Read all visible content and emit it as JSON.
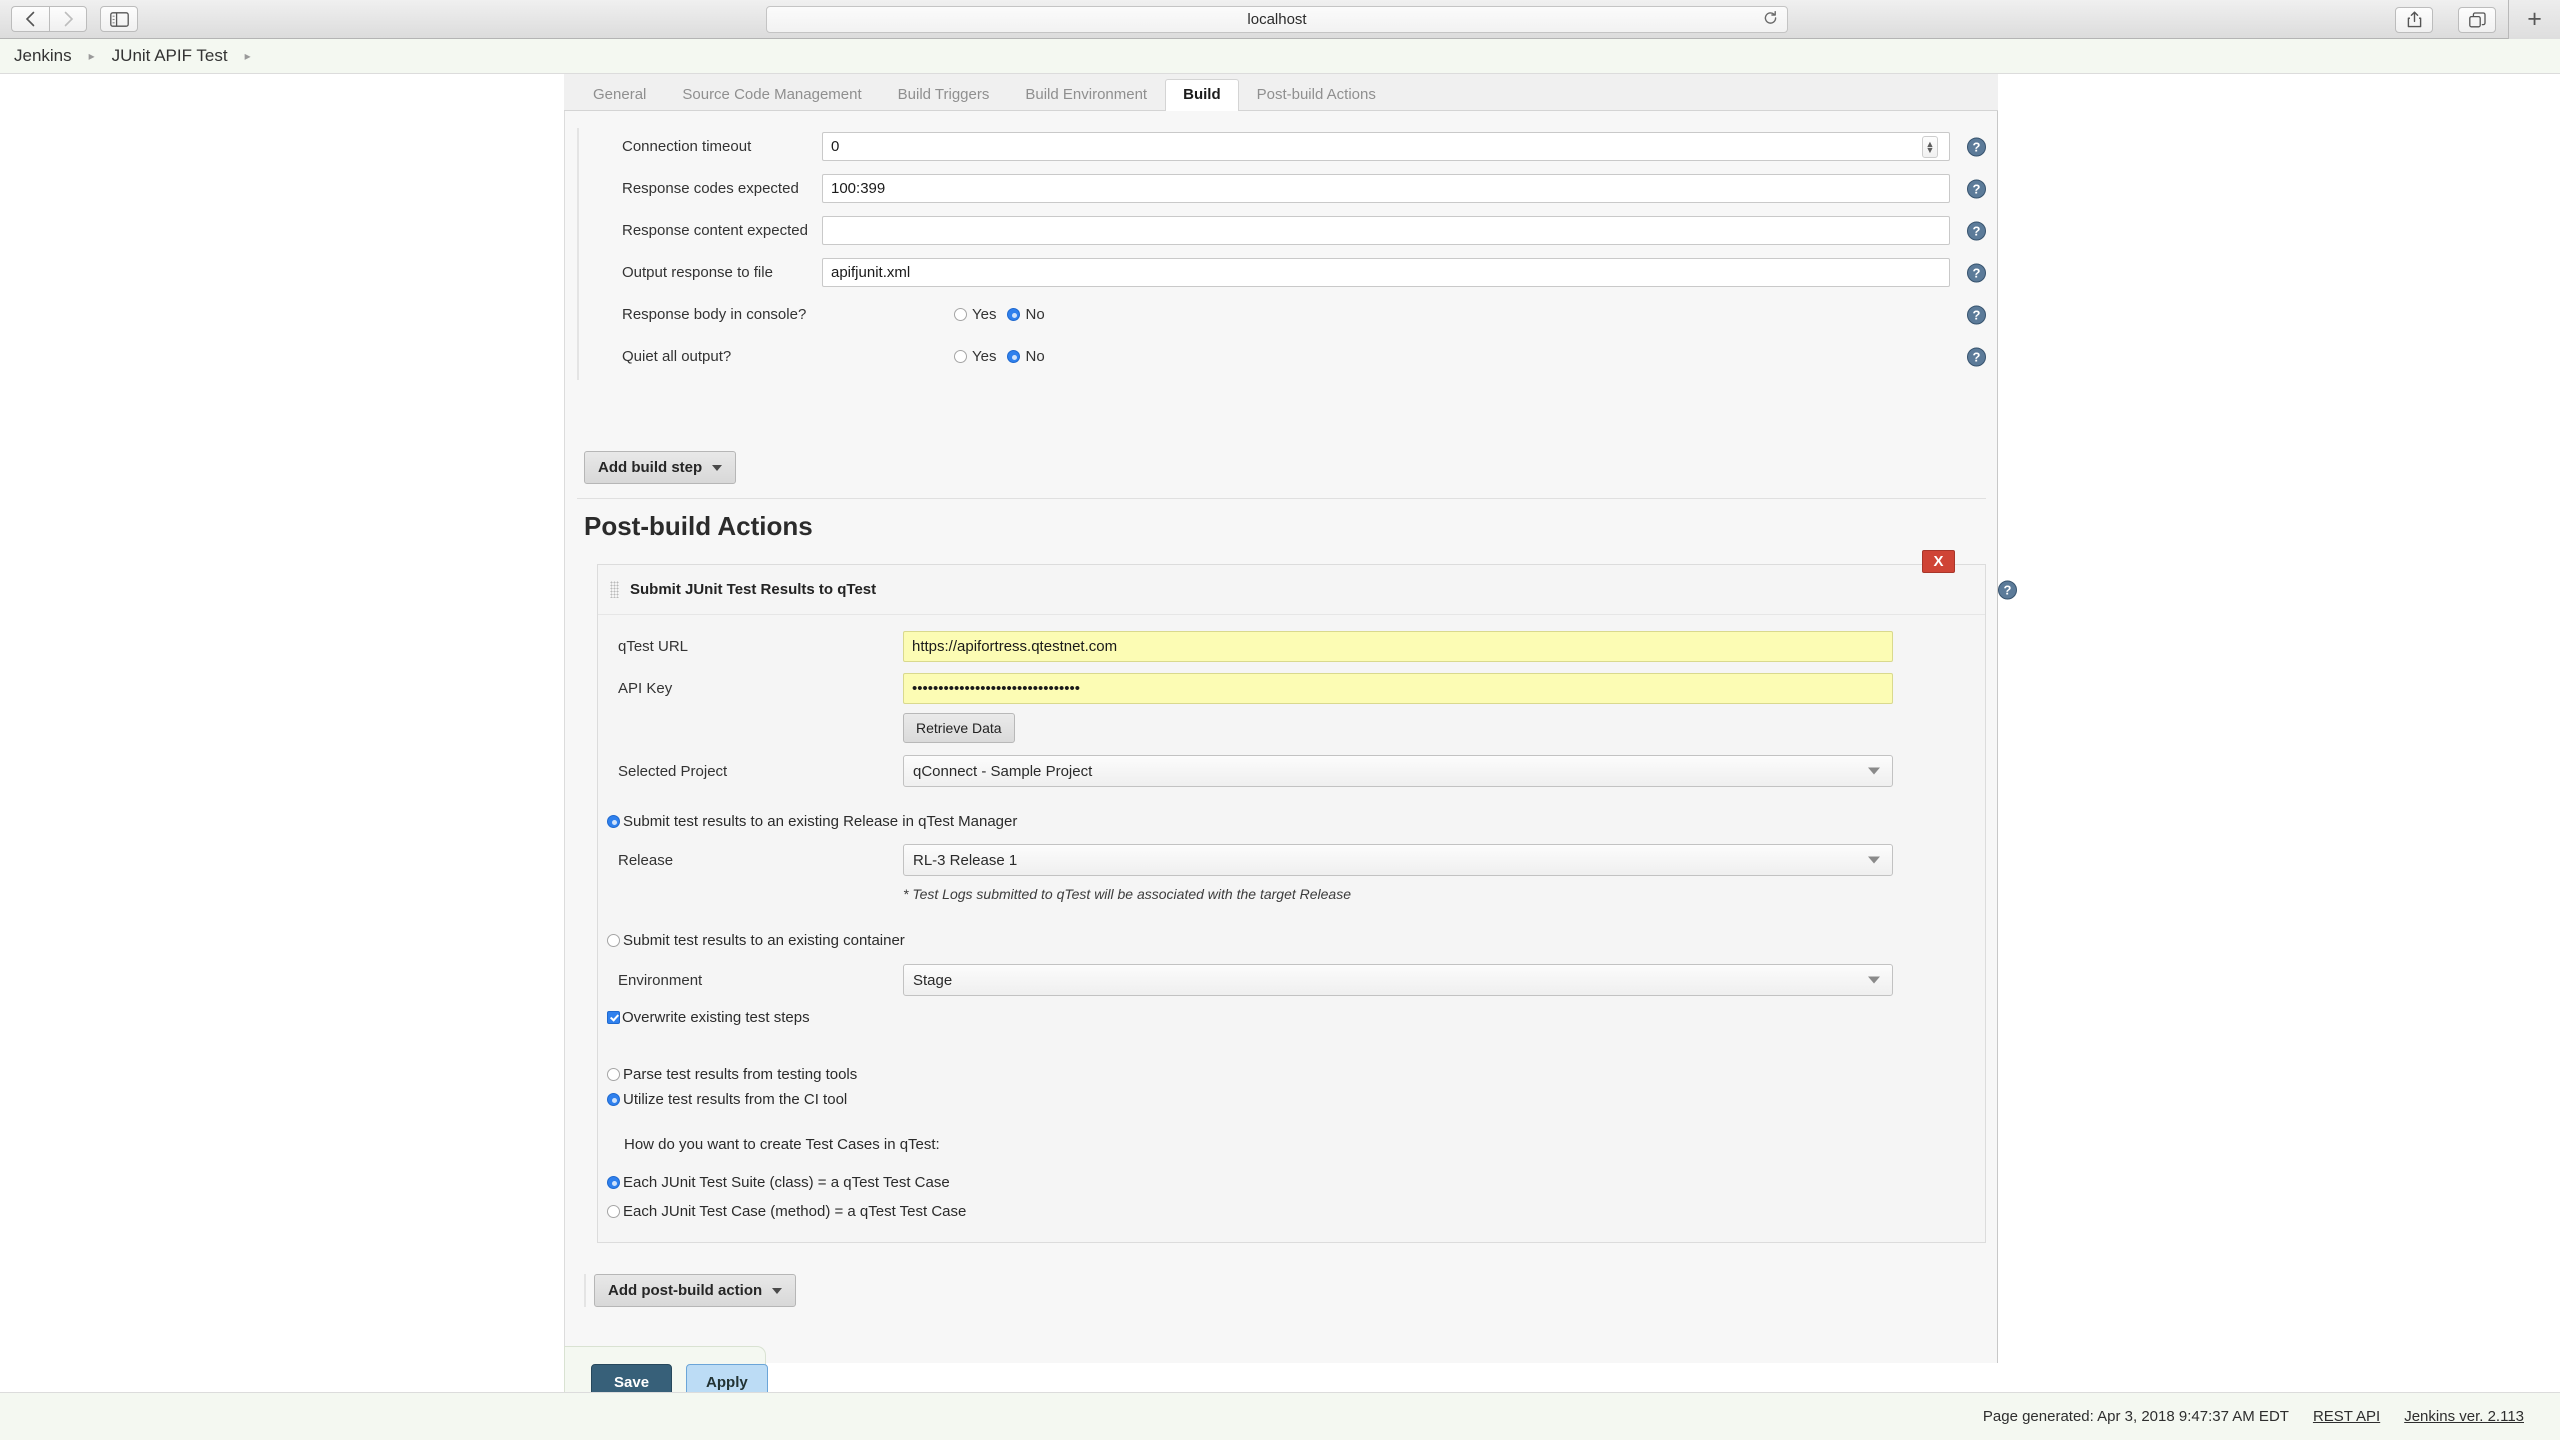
{
  "browser": {
    "url": "localhost",
    "back_icon": "chevron-left-icon",
    "forward_icon": "chevron-right-icon",
    "sidebar_icon": "sidebar-toggle-icon",
    "reload_icon": "reload-icon",
    "share_icon": "share-icon",
    "tabs_icon": "show-tabs-icon",
    "newtab_label": "+"
  },
  "breadcrumb": {
    "items": [
      {
        "label": "Jenkins"
      },
      {
        "label": "JUnit APIF Test"
      }
    ],
    "separator": "▸"
  },
  "tabs": [
    {
      "label": "General",
      "active": false
    },
    {
      "label": "Source Code Management",
      "active": false
    },
    {
      "label": "Build Triggers",
      "active": false
    },
    {
      "label": "Build Environment",
      "active": false
    },
    {
      "label": "Build",
      "active": true
    },
    {
      "label": "Post-build Actions",
      "active": false
    }
  ],
  "build_step": {
    "fields": [
      {
        "label": "Connection timeout",
        "value": "0",
        "type": "number"
      },
      {
        "label": "Response codes expected",
        "value": "100:399",
        "type": "text"
      },
      {
        "label": "Response content expected",
        "value": "",
        "type": "text"
      },
      {
        "label": "Output response to file",
        "value": "apifjunit.xml",
        "type": "text"
      }
    ],
    "radios": [
      {
        "label": "Response body in console?",
        "yes": "Yes",
        "no": "No",
        "selected": "No"
      },
      {
        "label": "Quiet all output?",
        "yes": "Yes",
        "no": "No",
        "selected": "No"
      }
    ],
    "add_build_step": "Add build step"
  },
  "post_build": {
    "heading": "Post-build Actions",
    "panel_title": "Submit JUnit Test Results to qTest",
    "delete_label": "X",
    "qtest_url": {
      "label": "qTest URL",
      "value": "https://apifortress.qtestnet.com"
    },
    "api_key": {
      "label": "API Key",
      "value": "••••••••••••••••••••••••••••••••"
    },
    "retrieve_data": "Retrieve Data",
    "selected_project": {
      "label": "Selected Project",
      "value": "qConnect - Sample Project"
    },
    "release_radio": {
      "label": "Submit test results to an existing Release in qTest Manager",
      "selected": true
    },
    "release": {
      "label": "Release",
      "value": "RL-3 Release 1"
    },
    "release_note": "* Test Logs submitted to qTest will be associated with the target Release",
    "container_radio": {
      "label": "Submit test results to an existing container",
      "selected": false
    },
    "environment": {
      "label": "Environment",
      "value": "Stage"
    },
    "overwrite": {
      "label": "Overwrite existing test steps",
      "checked": true
    },
    "parse_radio": {
      "label": "Parse test results from testing tools",
      "selected": false
    },
    "utilize_radio": {
      "label": "Utilize test results from the CI tool",
      "selected": true
    },
    "create_prompt": "How do you want to create Test Cases in qTest:",
    "suite_radio": {
      "label": "Each JUnit Test Suite (class) = a qTest Test Case",
      "selected": true
    },
    "case_radio": {
      "label": "Each JUnit Test Case (method) = a qTest Test Case",
      "selected": false
    },
    "add_post_build": "Add post-build action"
  },
  "actions": {
    "save": "Save",
    "apply": "Apply"
  },
  "footer": {
    "generated": "Page generated: Apr 3, 2018 9:47:37 AM EDT",
    "rest_api": "REST API",
    "version": "Jenkins ver. 2.113"
  },
  "colors": {
    "accent": "#2f80ed",
    "danger": "#cf4436",
    "save": "#376079",
    "apply": "#bcdcf5",
    "highlight": "#fcfcb4"
  }
}
